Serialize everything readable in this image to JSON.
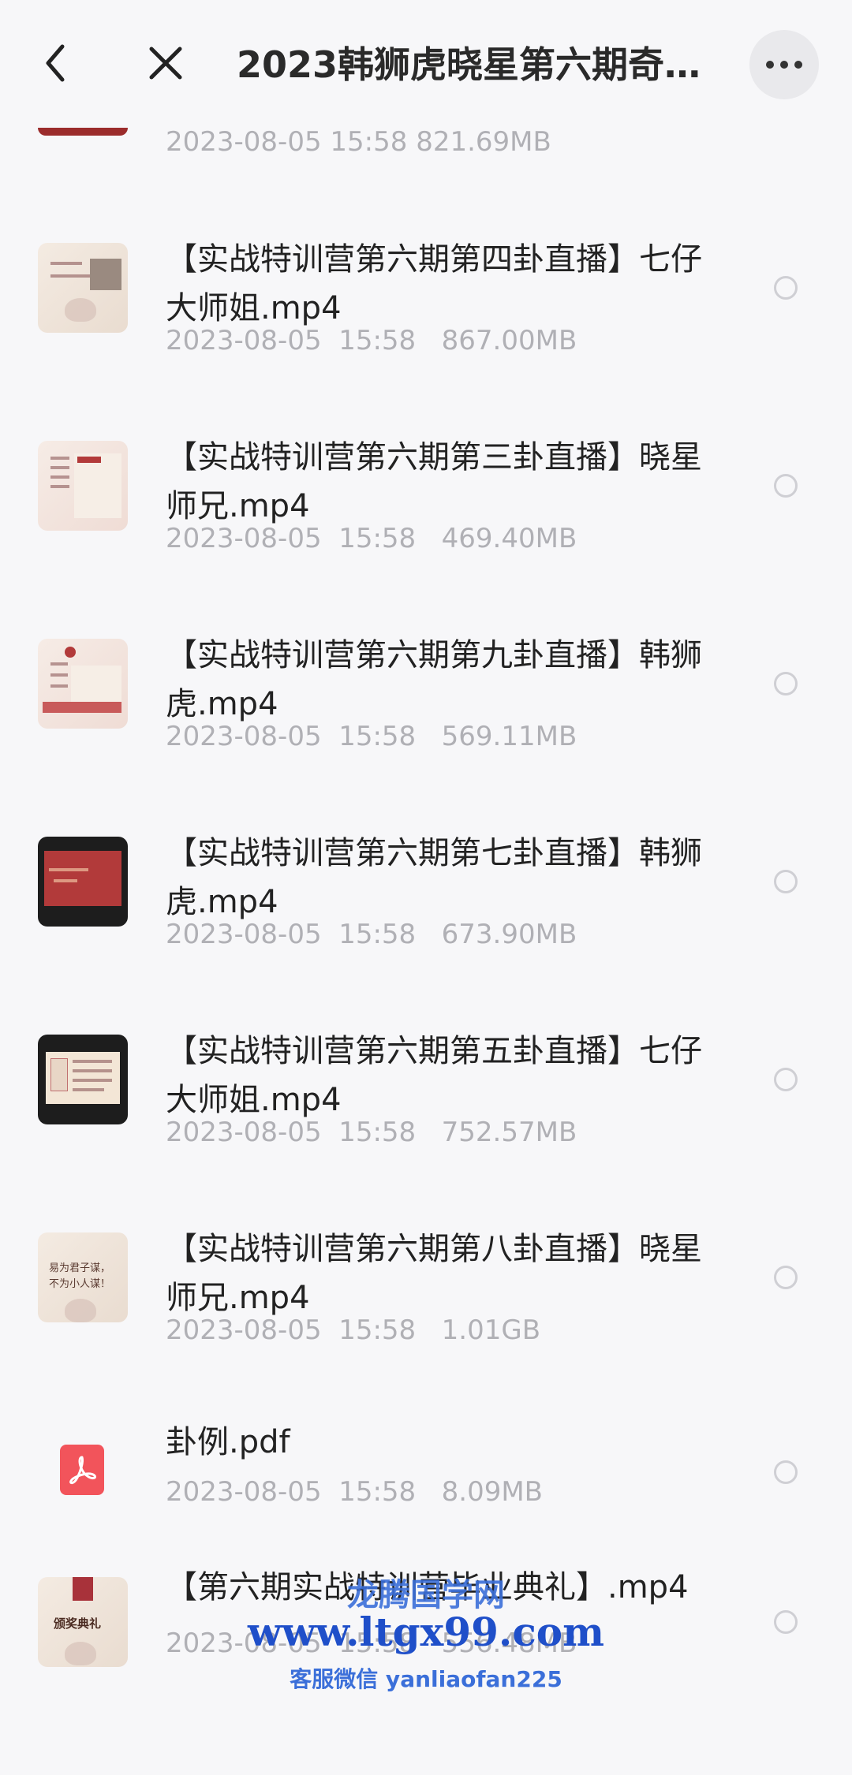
{
  "header": {
    "title": "2023韩狮虎晓星第六期奇…"
  },
  "partial_item": {
    "meta": "2023-08-05  15:58   821.69MB"
  },
  "files": [
    {
      "name": "【实战特训营第六期第四卦直播】七仔大师姐.mp4",
      "date": "2023-08-05  15:58",
      "size": "867.00MB",
      "thumb": "light"
    },
    {
      "name": "【实战特训营第六期第三卦直播】晓星师兄.mp4",
      "date": "2023-08-05  15:58",
      "size": "469.40MB",
      "thumb": "pink"
    },
    {
      "name": "【实战特训营第六期第九卦直播】韩狮虎.mp4",
      "date": "2023-08-05  15:58",
      "size": "569.11MB",
      "thumb": "pink"
    },
    {
      "name": "【实战特训营第六期第七卦直播】韩狮虎.mp4",
      "date": "2023-08-05  15:58",
      "size": "673.90MB",
      "thumb": "dark-red"
    },
    {
      "name": "【实战特训营第六期第五卦直播】七仔大师姐.mp4",
      "date": "2023-08-05  15:58",
      "size": "752.57MB",
      "thumb": "dark-paper"
    },
    {
      "name": "【实战特训营第六期第八卦直播】晓星师兄.mp4",
      "date": "2023-08-05  15:58",
      "size": "1.01GB",
      "thumb": "calligraphy"
    },
    {
      "name": "卦例.pdf",
      "date": "2023-08-05  15:58",
      "size": "8.09MB",
      "thumb": "pdf"
    },
    {
      "name": "【第六期实战特训营毕业典礼】.mp4",
      "date": "2023-08-05  15:58",
      "size": "556.48MB",
      "thumb": "ceremony"
    }
  ],
  "thumb_text": {
    "calligraphy": "易为君子谋，\n不为小人谋！",
    "ceremony": "颁奖典礼"
  },
  "watermark": {
    "site_name": "龙腾国学网",
    "url": "www.ltgx99.com",
    "contact": "客服微信 yanliaofan225"
  },
  "colors": {
    "background": "#f7f7f9",
    "meta_text": "#b0b0b5",
    "pdf_red": "#f2545b",
    "watermark_blue": "#1f4fc9"
  }
}
